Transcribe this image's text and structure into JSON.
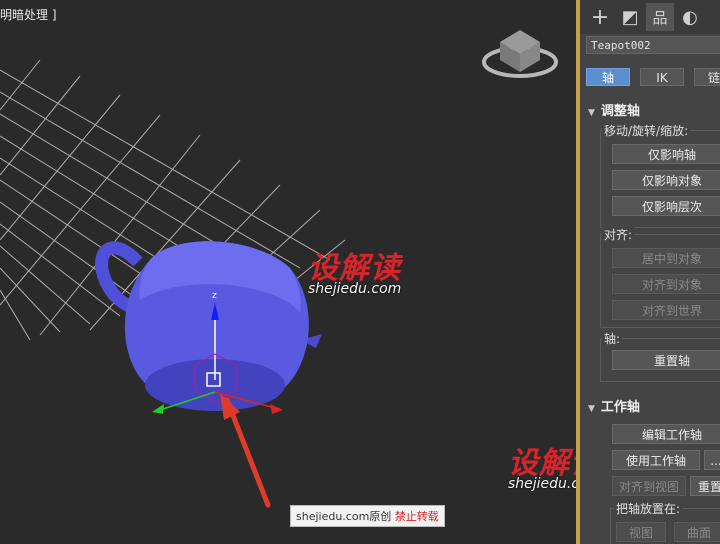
{
  "viewport": {
    "label": "明暗处理 ]",
    "gizmo_label": "z",
    "watermark1": {
      "logo": "设解读",
      "url": "shejiedu.com"
    },
    "watermark2": {
      "logo": "设解读",
      "url": "shejiedu.com"
    },
    "credit": {
      "text": "shejiedu.com原创 ",
      "red": "禁止转载"
    }
  },
  "panel": {
    "tabs": [
      {
        "name": "create",
        "glyph": "+"
      },
      {
        "name": "modify",
        "glyph": "◩"
      },
      {
        "name": "hierarchy",
        "glyph": "品"
      },
      {
        "name": "motion",
        "glyph": "◐"
      }
    ],
    "object_name": "Teapot002",
    "tab_buttons": {
      "pivot": "轴",
      "ik": "IK",
      "link": "链"
    },
    "adjust_pivot": {
      "title": "调整轴",
      "move_group": "移动/旋转/缩放:",
      "affect_pivot": "仅影响轴",
      "affect_object": "仅影响对象",
      "affect_hierarchy": "仅影响层次",
      "align_group": "对齐:",
      "center_to_object": "居中到对象",
      "align_to_object": "对齐到对象",
      "align_to_world": "对齐到世界",
      "pivot_group": "轴:",
      "reset_pivot": "重置轴"
    },
    "working_pivot": {
      "title": "工作轴",
      "edit_working_pivot": "编辑工作轴",
      "use_working_pivot": "使用工作轴",
      "more": "...",
      "align_to_view": "对齐到视图",
      "reset": "重置",
      "place_pivot_group": "把轴放置在:",
      "view": "视图",
      "surface": "曲面"
    }
  }
}
